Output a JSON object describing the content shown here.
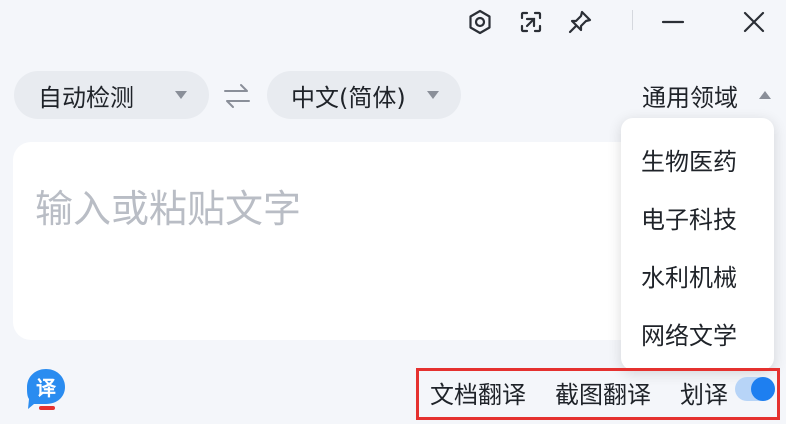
{
  "titlebar": {
    "buttons": [
      {
        "icon": "settings-icon"
      },
      {
        "icon": "screenshot-icon"
      },
      {
        "icon": "pin-icon"
      },
      {
        "icon": "minimize-icon"
      },
      {
        "icon": "close-icon"
      }
    ]
  },
  "languages": {
    "source": "自动检测",
    "target": "中文(简体)",
    "swap_icon": "swap-icon"
  },
  "domain": {
    "label": "通用领域",
    "options": [
      "生物医药",
      "电子科技",
      "水利机械",
      "网络文学"
    ]
  },
  "input": {
    "placeholder": "输入或粘贴文字"
  },
  "footer": {
    "doc_translate": "文档翻译",
    "screenshot_translate": "截图翻译",
    "selection_translate": "划译",
    "selection_toggle_on": true,
    "logo_text": "译"
  },
  "colors": {
    "accent": "#1e7ff0",
    "highlight": "#e5312f",
    "background": "#f4f6fa"
  }
}
